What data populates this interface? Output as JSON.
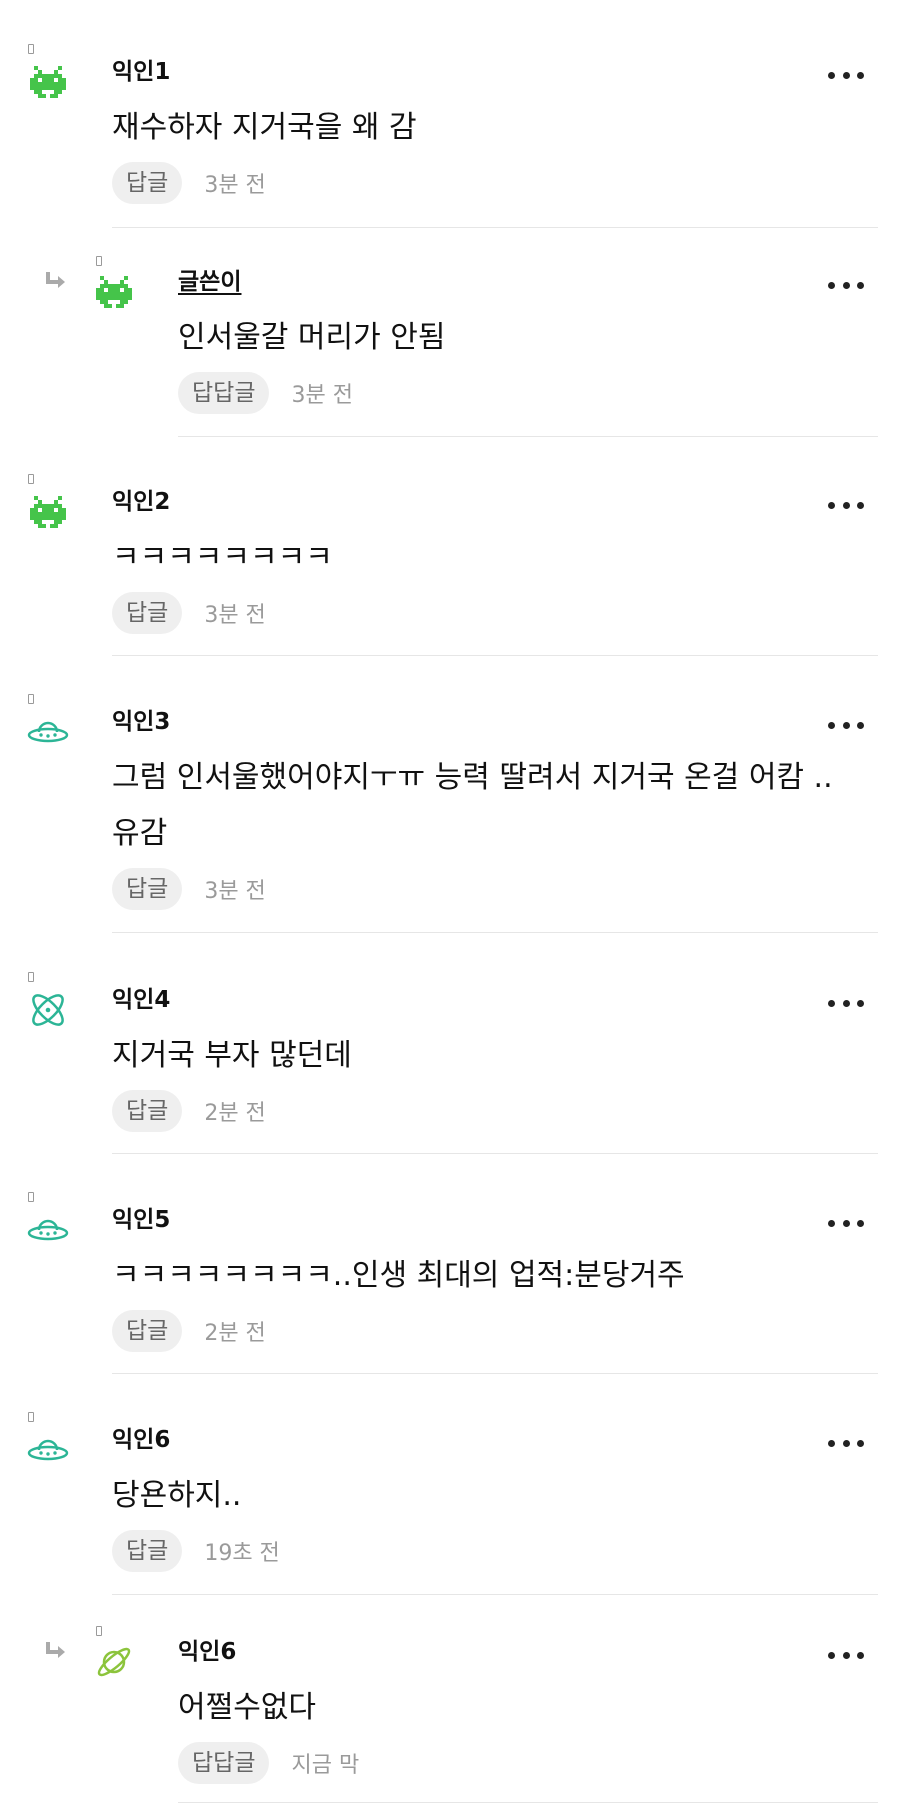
{
  "colors": {
    "green_icon": "#45c44a",
    "teal_icon": "#2cb596",
    "lime_icon": "#8cc43c",
    "pill_bg": "#efefef",
    "time_text": "#9a9a9a"
  },
  "comments": [
    {
      "author": "익인1",
      "text": "재수하자 지거국을 왜 감",
      "reply_label": "답글",
      "time": "3분 전",
      "icon": "space-invader-icon"
    },
    {
      "author": "글쓴이",
      "text": "인서울갈 머리가 안됨",
      "reply_label": "답답글",
      "time": "3분 전",
      "icon": "space-invader-icon"
    },
    {
      "author": "익인2",
      "text": "ㅋㅋㅋㅋㅋㅋㅋㅋ",
      "reply_label": "답글",
      "time": "3분 전",
      "icon": "space-invader-icon"
    },
    {
      "author": "익인3",
      "text": "그럼 인서울했어야지ㅜㅠ 능력 딸려서 지거국 온걸 어캄 ..유감",
      "reply_label": "답글",
      "time": "3분 전",
      "icon": "ufo-icon"
    },
    {
      "author": "익인4",
      "text": "지거국 부자 많던데",
      "reply_label": "답글",
      "time": "2분 전",
      "icon": "atom-icon"
    },
    {
      "author": "익인5",
      "text": "ㅋㅋㅋㅋㅋㅋㅋㅋ..인생 최대의 업적:분당거주",
      "reply_label": "답글",
      "time": "2분 전",
      "icon": "ufo-icon"
    },
    {
      "author": "익인6",
      "text": "당욘하지..",
      "reply_label": "답글",
      "time": "19초 전",
      "icon": "ufo-icon"
    },
    {
      "author": "익인6",
      "text": "어쩔수없다",
      "reply_label": "답답글",
      "time": "지금 막",
      "icon": "planet-icon"
    }
  ]
}
